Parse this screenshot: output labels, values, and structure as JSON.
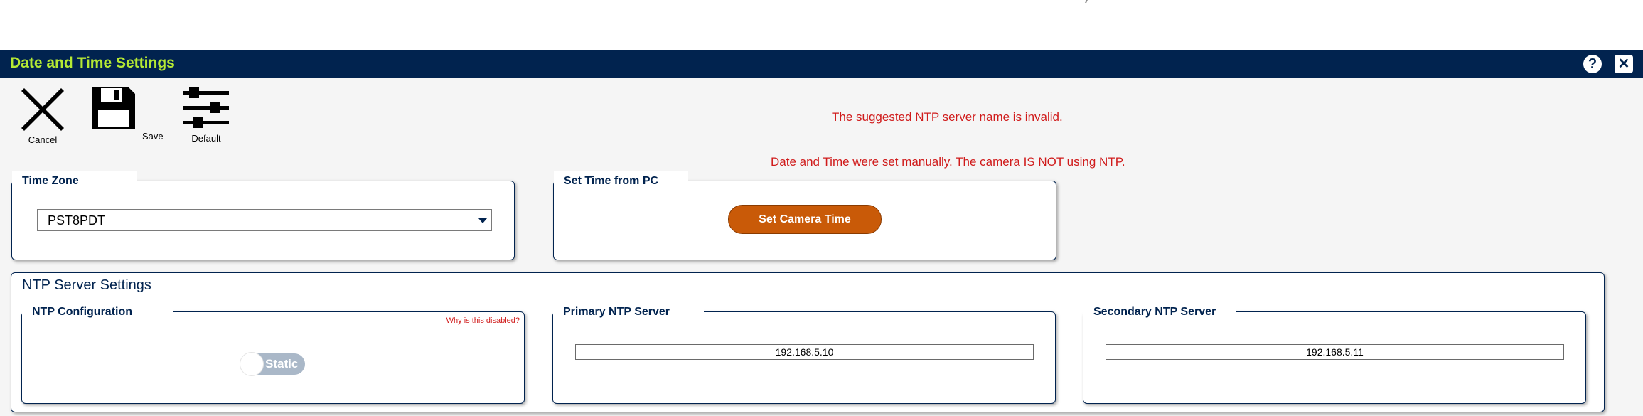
{
  "window": {
    "title": "Date and Time Settings",
    "help_icon": "question-circle-icon",
    "close_icon": "close-icon"
  },
  "toolbar": {
    "cancel_label": "Cancel",
    "save_label": "Save",
    "default_label": "Default"
  },
  "messages": {
    "invalid_ntp": "The suggested NTP server name is invalid.",
    "manual_time": "Date and Time were set manually. The camera IS NOT using NTP."
  },
  "time_zone": {
    "legend": "Time Zone",
    "value": "PST8PDT"
  },
  "set_time_pc": {
    "legend": "Set Time from PC",
    "button_label": "Set Camera Time"
  },
  "ntp": {
    "section_title": "NTP Server Settings",
    "config_legend": "NTP Configuration",
    "why_disabled": "Why is this disabled?",
    "mode_label": "Static",
    "primary_legend": "Primary NTP Server",
    "primary_value": "192.168.5.10",
    "secondary_legend": "Secondary NTP Server",
    "secondary_value": "192.168.5.11"
  },
  "colors": {
    "header_bg": "#01234f",
    "title_text": "#b5e934",
    "error_text": "#d01b1b",
    "button_orange": "#c95a08"
  }
}
